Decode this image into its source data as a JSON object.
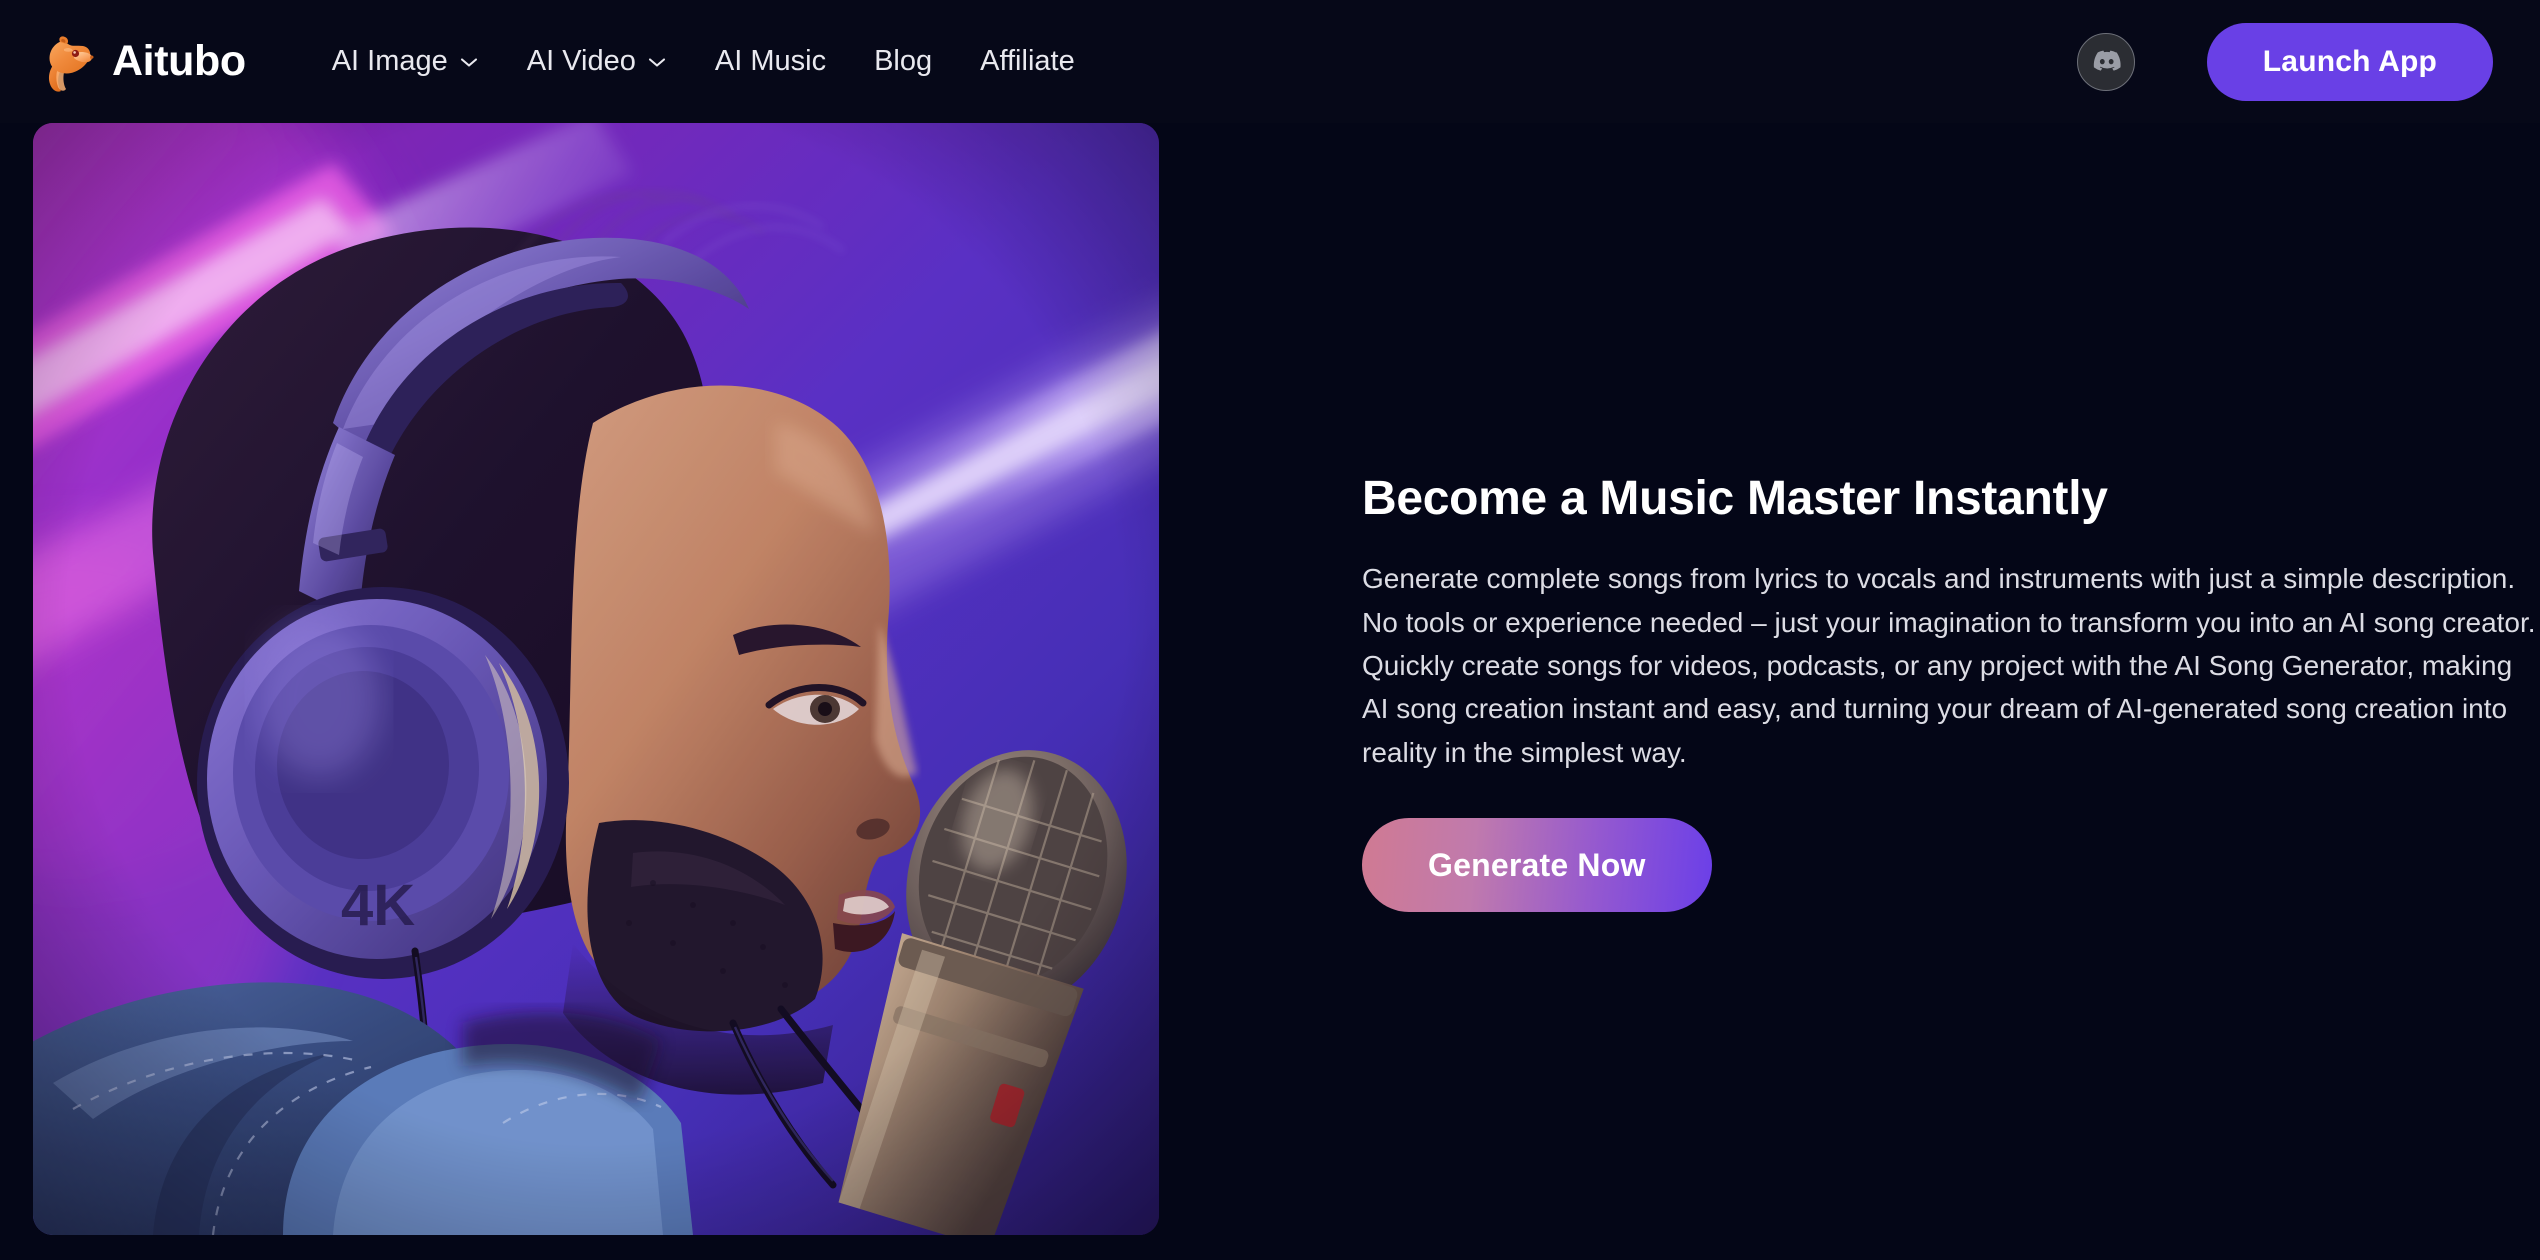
{
  "brand": {
    "name": "Aitubo",
    "logo_icon": "otter-mascot-logo"
  },
  "nav": {
    "items": [
      {
        "label": "AI Image",
        "has_dropdown": true,
        "icon": "chevron-down-icon"
      },
      {
        "label": "AI Video",
        "has_dropdown": true,
        "icon": "chevron-down-icon"
      },
      {
        "label": "AI Music",
        "has_dropdown": false,
        "icon": ""
      },
      {
        "label": "Blog",
        "has_dropdown": false,
        "icon": ""
      },
      {
        "label": "Affiliate",
        "has_dropdown": false,
        "icon": ""
      }
    ]
  },
  "header_actions": {
    "discord_icon": "discord-icon",
    "launch_app_label": "Launch App"
  },
  "hero": {
    "image_alt": "Bearded man wearing 4K over-ear headphones singing into a studio condenser microphone under purple and magenta neon lighting",
    "image_headphone_label": "4K",
    "title": "Become a Music Master Instantly",
    "description": "Generate complete songs from lyrics to vocals and instruments with just a simple description. No tools or experience needed – just your imagination to transform you into an AI song creator. Quickly create songs for videos, podcasts, or any project with the AI Song Generator, making AI song creation instant and easy, and turning your dream of AI-generated song creation into reality in the simplest way.",
    "cta_label": "Generate Now"
  },
  "colors": {
    "page_background": "#040617",
    "header_background": "#060818",
    "brand_orange": "#F08A3C",
    "accent_purple": "#6940E6",
    "cta_gradient_start": "#D07A92",
    "cta_gradient_end": "#6B3FE8",
    "nav_text": "#E9E9EF",
    "body_text": "#DCDCE4"
  }
}
